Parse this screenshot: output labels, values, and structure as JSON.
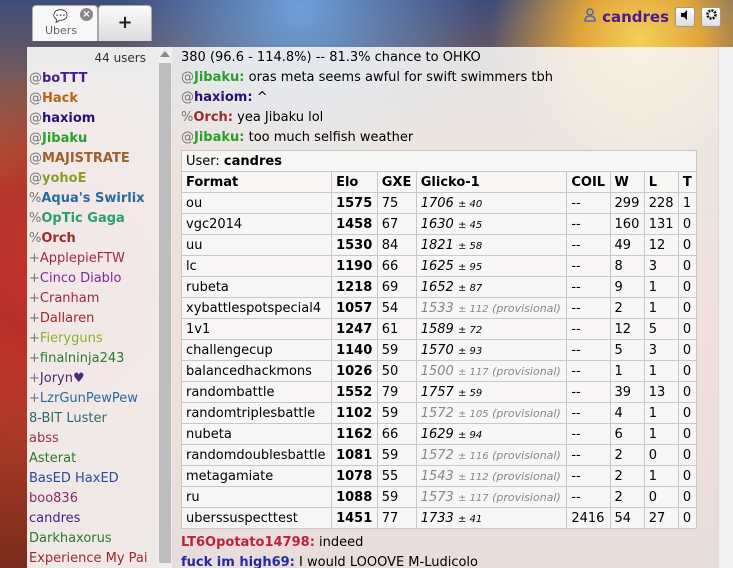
{
  "header": {
    "tabs": [
      {
        "label": "Ubers",
        "icon": "chat-bubble-icon",
        "close": "×"
      }
    ],
    "add_tab_label": "+",
    "username": "candres",
    "user_icon": "user-icon",
    "sound_icon": "speaker-icon",
    "settings_icon": "gear-icon"
  },
  "userlist": {
    "count": "44 users",
    "users": [
      {
        "rank": "@",
        "name": "boTTT",
        "color": "#4a1c8c",
        "bold": true
      },
      {
        "rank": "@",
        "name": "Hack",
        "color": "#b8621a",
        "bold": true
      },
      {
        "rank": "@",
        "name": "haxiom",
        "color": "#2a0f7a",
        "bold": true
      },
      {
        "rank": "@",
        "name": "Jibaku",
        "color": "#2aa02a",
        "bold": true
      },
      {
        "rank": "@",
        "name": "MAJISTRATE",
        "color": "#a0602a",
        "bold": true
      },
      {
        "rank": "@",
        "name": "yohoE",
        "color": "#8aa02a",
        "bold": true
      },
      {
        "rank": "%",
        "name": "Aqua's Swirlix",
        "color": "#2a6aa0",
        "bold": true
      },
      {
        "rank": "%",
        "name": "OpTic Gaga",
        "color": "#2aa06a",
        "bold": true
      },
      {
        "rank": "%",
        "name": "Orch",
        "color": "#a02a2a",
        "bold": true
      },
      {
        "rank": "+",
        "name": "ApplepieFTW",
        "color": "#a02a4a",
        "bold": false
      },
      {
        "rank": "+",
        "name": "Cinco Diablo",
        "color": "#7a2aa0",
        "bold": false
      },
      {
        "rank": "+",
        "name": "Cranham",
        "color": "#a02a3a",
        "bold": false
      },
      {
        "rank": "+",
        "name": "Dallaren",
        "color": "#a02a2a",
        "bold": false
      },
      {
        "rank": "+",
        "name": "Fieryguns",
        "color": "#8ab02a",
        "bold": false
      },
      {
        "rank": "+",
        "name": "finalninja243",
        "color": "#2a7a2a",
        "bold": false
      },
      {
        "rank": "+",
        "name": "Joryn♥",
        "color": "#4a2a7a",
        "bold": false
      },
      {
        "rank": "+",
        "name": "LzrGunPewPew",
        "color": "#2a6aa0",
        "bold": false
      },
      {
        "rank": "",
        "name": "8-BIT Luster",
        "color": "#2a6a6a",
        "bold": false
      },
      {
        "rank": "",
        "name": "abss",
        "color": "#a02a4a",
        "bold": false
      },
      {
        "rank": "",
        "name": "Asterat",
        "color": "#2a7a2a",
        "bold": false
      },
      {
        "rank": "",
        "name": "BasED HaxED",
        "color": "#2a4aa0",
        "bold": false
      },
      {
        "rank": "",
        "name": "boo836",
        "color": "#8a2a6a",
        "bold": false
      },
      {
        "rank": "",
        "name": "candres",
        "color": "#4a1c8c",
        "bold": false
      },
      {
        "rank": "",
        "name": "Darkhaxorus",
        "color": "#2a7a2a",
        "bold": false
      },
      {
        "rank": "",
        "name": "Experience My Pai",
        "color": "#a02a2a",
        "bold": false
      }
    ]
  },
  "chat": {
    "messages": [
      {
        "rank": "",
        "name": "",
        "text": "380 (96.6 - 114.8%) -- 81.3% chance to OHKO",
        "color": "#000"
      },
      {
        "rank": "@",
        "name": "Jibaku:",
        "text": "oras meta seems awful for swift swimmers tbh",
        "color": "#2aa02a"
      },
      {
        "rank": "@",
        "name": "haxiom:",
        "text": "^",
        "color": "#2a0f7a"
      },
      {
        "rank": "%",
        "name": "Orch:",
        "text": "yea Jibaku lol",
        "color": "#a02a2a"
      },
      {
        "rank": "@",
        "name": "Jibaku:",
        "text": "too much selfish weather",
        "color": "#2aa02a"
      }
    ],
    "after": [
      {
        "rank": "",
        "name": "LT6Opotato14798:",
        "text": "indeed",
        "color": "#c02040"
      },
      {
        "rank": "",
        "name": "fuck im high69:",
        "text": "I would LOOOVE M-Ludicolo",
        "color": "#2a2aa0"
      }
    ]
  },
  "stats": {
    "user_label": "User:",
    "user_name": "candres",
    "headers": [
      "Format",
      "Elo",
      "GXE",
      "Glicko-1",
      "COIL",
      "W",
      "L",
      "T"
    ],
    "rows": [
      {
        "format": "ou",
        "elo": "1575",
        "gxe": "75",
        "glicko": "1706",
        "dev": "± 40",
        "prov": "",
        "coil": "--",
        "w": "299",
        "l": "228",
        "t": "1"
      },
      {
        "format": "vgc2014",
        "elo": "1458",
        "gxe": "67",
        "glicko": "1630",
        "dev": "± 45",
        "prov": "",
        "coil": "--",
        "w": "160",
        "l": "131",
        "t": "0"
      },
      {
        "format": "uu",
        "elo": "1530",
        "gxe": "84",
        "glicko": "1821",
        "dev": "± 58",
        "prov": "",
        "coil": "--",
        "w": "49",
        "l": "12",
        "t": "0"
      },
      {
        "format": "lc",
        "elo": "1190",
        "gxe": "66",
        "glicko": "1625",
        "dev": "± 95",
        "prov": "",
        "coil": "--",
        "w": "8",
        "l": "3",
        "t": "0"
      },
      {
        "format": "rubeta",
        "elo": "1218",
        "gxe": "69",
        "glicko": "1652",
        "dev": "± 87",
        "prov": "",
        "coil": "--",
        "w": "9",
        "l": "1",
        "t": "0"
      },
      {
        "format": "xybattlespotspecial4",
        "elo": "1057",
        "gxe": "54",
        "glicko": "1533",
        "dev": "± 112",
        "prov": "(provisional)",
        "coil": "--",
        "w": "2",
        "l": "1",
        "t": "0"
      },
      {
        "format": "1v1",
        "elo": "1247",
        "gxe": "61",
        "glicko": "1589",
        "dev": "± 72",
        "prov": "",
        "coil": "--",
        "w": "12",
        "l": "5",
        "t": "0"
      },
      {
        "format": "challengecup",
        "elo": "1140",
        "gxe": "59",
        "glicko": "1570",
        "dev": "± 93",
        "prov": "",
        "coil": "--",
        "w": "5",
        "l": "3",
        "t": "0"
      },
      {
        "format": "balancedhackmons",
        "elo": "1026",
        "gxe": "50",
        "glicko": "1500",
        "dev": "± 117",
        "prov": "(provisional)",
        "coil": "--",
        "w": "1",
        "l": "1",
        "t": "0"
      },
      {
        "format": "randombattle",
        "elo": "1552",
        "gxe": "79",
        "glicko": "1757",
        "dev": "± 59",
        "prov": "",
        "coil": "--",
        "w": "39",
        "l": "13",
        "t": "0"
      },
      {
        "format": "randomtriplesbattle",
        "elo": "1102",
        "gxe": "59",
        "glicko": "1572",
        "dev": "± 105",
        "prov": "(provisional)",
        "coil": "--",
        "w": "4",
        "l": "1",
        "t": "0"
      },
      {
        "format": "nubeta",
        "elo": "1162",
        "gxe": "66",
        "glicko": "1629",
        "dev": "± 94",
        "prov": "",
        "coil": "--",
        "w": "6",
        "l": "1",
        "t": "0"
      },
      {
        "format": "randomdoublesbattle",
        "elo": "1081",
        "gxe": "59",
        "glicko": "1572",
        "dev": "± 116",
        "prov": "(provisional)",
        "coil": "--",
        "w": "2",
        "l": "0",
        "t": "0"
      },
      {
        "format": "metagamiate",
        "elo": "1078",
        "gxe": "55",
        "glicko": "1543",
        "dev": "± 112",
        "prov": "(provisional)",
        "coil": "--",
        "w": "2",
        "l": "1",
        "t": "0"
      },
      {
        "format": "ru",
        "elo": "1088",
        "gxe": "59",
        "glicko": "1573",
        "dev": "± 117",
        "prov": "(provisional)",
        "coil": "--",
        "w": "2",
        "l": "0",
        "t": "0"
      },
      {
        "format": "uberssuspecttest",
        "elo": "1451",
        "gxe": "77",
        "glicko": "1733",
        "dev": "± 41",
        "prov": "",
        "coil": "2416",
        "w": "54",
        "l": "27",
        "t": "0"
      }
    ]
  }
}
